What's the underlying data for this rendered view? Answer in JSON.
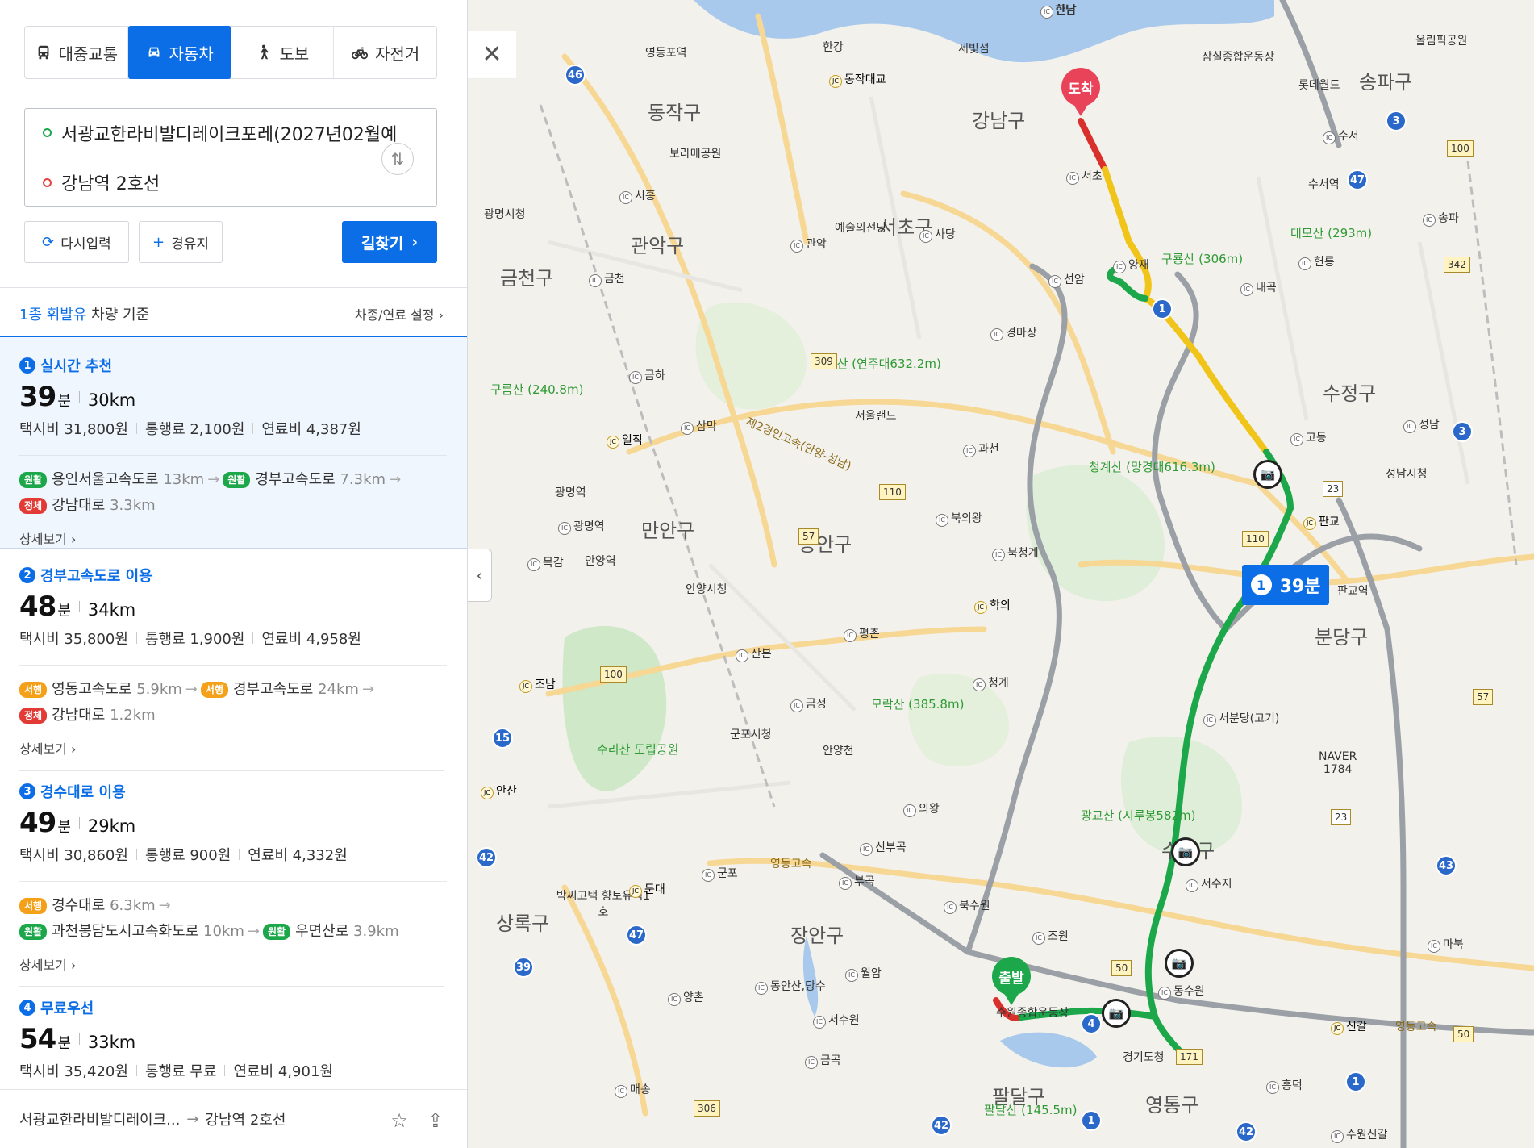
{
  "modes": [
    {
      "label": "대중교통",
      "icon": "bus-icon"
    },
    {
      "label": "자동차",
      "icon": "car-icon",
      "active": true
    },
    {
      "label": "도보",
      "icon": "walk-icon"
    },
    {
      "label": "자전거",
      "icon": "bicycle-icon"
    }
  ],
  "origin": "서광교한라비발디레이크포레(2027년02월예",
  "destination": "강남역 2호선",
  "buttons": {
    "reset": "다시입력",
    "waypoint": "경유지",
    "find": "길찾기"
  },
  "fuel": {
    "grade": "1종 휘발유",
    "suffix": " 차량 기준",
    "settings": "차종/연료 설정"
  },
  "routes": [
    {
      "num": "1",
      "title": "실시간 추천",
      "minutes": "39",
      "unit": "분",
      "km": "30km",
      "taxi": "택시비 31,800원",
      "toll": "통행료 2,100원",
      "fuelcost": "연료비 4,387원",
      "line1": [
        {
          "tag": "원활",
          "cls": "g",
          "road": "용인서울고속도로",
          "km": "13km"
        },
        {
          "tag": "원활",
          "cls": "g",
          "road": "경부고속도로",
          "km": "7.3km"
        }
      ],
      "line2": [
        {
          "tag": "정체",
          "cls": "r",
          "road": "강남대로",
          "km": "3.3km"
        }
      ],
      "detail": "상세보기"
    },
    {
      "num": "2",
      "title": "경부고속도로 이용",
      "minutes": "48",
      "unit": "분",
      "km": "34km",
      "taxi": "택시비 35,800원",
      "toll": "통행료 1,900원",
      "fuelcost": "연료비 4,958원",
      "line1": [
        {
          "tag": "서행",
          "cls": "o",
          "road": "영동고속도로",
          "km": "5.9km"
        },
        {
          "tag": "서행",
          "cls": "o",
          "road": "경부고속도로",
          "km": "24km"
        }
      ],
      "line2": [
        {
          "tag": "정체",
          "cls": "r",
          "road": "강남대로",
          "km": "1.2km"
        }
      ],
      "detail": "상세보기"
    },
    {
      "num": "3",
      "title": "경수대로 이용",
      "minutes": "49",
      "unit": "분",
      "km": "29km",
      "taxi": "택시비 30,860원",
      "toll": "통행료 900원",
      "fuelcost": "연료비 4,332원",
      "line1": [
        {
          "tag": "서행",
          "cls": "o",
          "road": "경수대로",
          "km": "6.3km"
        }
      ],
      "line2": [
        {
          "tag": "원활",
          "cls": "g",
          "road": "과천봉담도시고속화도로",
          "km": "10km"
        },
        {
          "tag": "원활",
          "cls": "g",
          "road": "우면산로",
          "km": "3.9km"
        }
      ],
      "detail": "상세보기"
    },
    {
      "num": "4",
      "title": "무료우선",
      "minutes": "54",
      "unit": "분",
      "km": "33km",
      "taxi": "택시비 35,420원",
      "toll": "통행료 무료",
      "fuelcost": "연료비 4,901원"
    }
  ],
  "bottom": {
    "from": "서광교한라비발디레이크...",
    "to": "강남역 2호선"
  },
  "map": {
    "route_time": "39분",
    "route_num": "1",
    "dest_label": "도착",
    "start_label": "출발",
    "naver": "NAVER",
    "naver_num": "1784",
    "colors": {
      "green": "#1ca74a",
      "yellow": "#f0c419",
      "red": "#d9302c",
      "blue": "#0b6ee6"
    },
    "districts": [
      "동작구",
      "강남구",
      "서초구",
      "관악구",
      "금천구",
      "수정구",
      "만안구",
      "동안구",
      "분당구",
      "수지구",
      "장안구",
      "상록구",
      "팔달구",
      "영통구",
      "송파구"
    ],
    "places": [
      "한강",
      "세빛섬",
      "영등포역",
      "보라매공원",
      "광명시청",
      "예술의전당",
      "잠실종합운동장",
      "올림픽공원",
      "롯데월드",
      "서울랜드",
      "안양시청",
      "안양역",
      "군포시청",
      "안양천",
      "광명역",
      "박씨고택 향토유적1호",
      "수원종합운동장",
      "경기도청",
      "성남시청",
      "판교역",
      "수서역",
      "한남"
    ],
    "mountains": [
      "관악산 (연주대632.2m)",
      "청계산 (망경대616.3m)",
      "구룡산 (306m)",
      "대모산 (293m)",
      "모락산 (385.8m)",
      "광교산 (시루봉582m)",
      "구름산 (240.8m)",
      "수리산 도립공원",
      "팔달산 (145.5m)"
    ],
    "ics": [
      "서초",
      "양재",
      "선암",
      "내곡",
      "경마장",
      "과천",
      "북의왕",
      "북청계",
      "학의",
      "청계",
      "의왕",
      "평촌",
      "산본",
      "금정",
      "삼막",
      "일직",
      "광명역",
      "목감",
      "조남",
      "안산",
      "둔대",
      "군포",
      "부곡",
      "신부곡",
      "북수원",
      "조원",
      "월암",
      "동안산,당수",
      "서수원",
      "금곡",
      "양촌",
      "매송",
      "동수원",
      "서수지",
      "서분당(고기)",
      "판교",
      "고등",
      "헌릉",
      "수서",
      "송파",
      "성남",
      "마북",
      "신갈",
      "흥덕",
      "수원신갈",
      "사당",
      "관악",
      "시흥",
      "금천",
      "금하",
      "동작대교",
      "한남"
    ],
    "highways": [
      "제2경인고속(안양-성남)",
      "영동고속",
      "영동고속"
    ],
    "shields": [
      "46",
      "47",
      "1",
      "110",
      "57",
      "309",
      "100",
      "15",
      "42",
      "47",
      "39",
      "50",
      "4",
      "171",
      "42",
      "1",
      "3",
      "100",
      "23",
      "110",
      "3",
      "23",
      "57",
      "43",
      "1",
      "50",
      "42",
      "342",
      "306"
    ]
  }
}
